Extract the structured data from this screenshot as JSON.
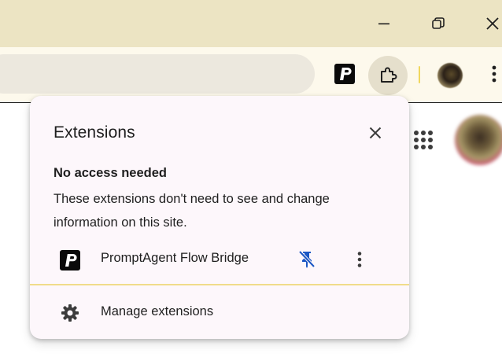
{
  "window": {
    "minimize_icon": "minimize-icon",
    "restore_icon": "restore-icon",
    "close_icon": "close-icon",
    "titlebar_color": "#ece4c3"
  },
  "toolbar": {
    "omnibox_value": "",
    "extension_icons": [
      "promptagent-logo-icon",
      "puzzle-piece-icon"
    ],
    "profile_icon": "avatar",
    "menu_icon": "vertical-dots-icon",
    "toolbar_color": "#fdf9ec"
  },
  "popup": {
    "title": "Extensions",
    "close_icon": "close-icon",
    "section_heading": "No access needed",
    "section_description": "These extensions don't need to see and change information on this site.",
    "extensions": [
      {
        "name": "PromptAgent Flow Bridge",
        "icon": "promptagent-logo-icon",
        "pinned": true
      }
    ],
    "manage_label": "Manage extensions",
    "manage_icon": "gear-icon",
    "accent_color": "#1a56c4",
    "separator_color": "#f0dc8a",
    "background_color": "#fdf7fb"
  },
  "page": {
    "apps_icon": "apps-grid-icon",
    "avatar": "avatar"
  }
}
